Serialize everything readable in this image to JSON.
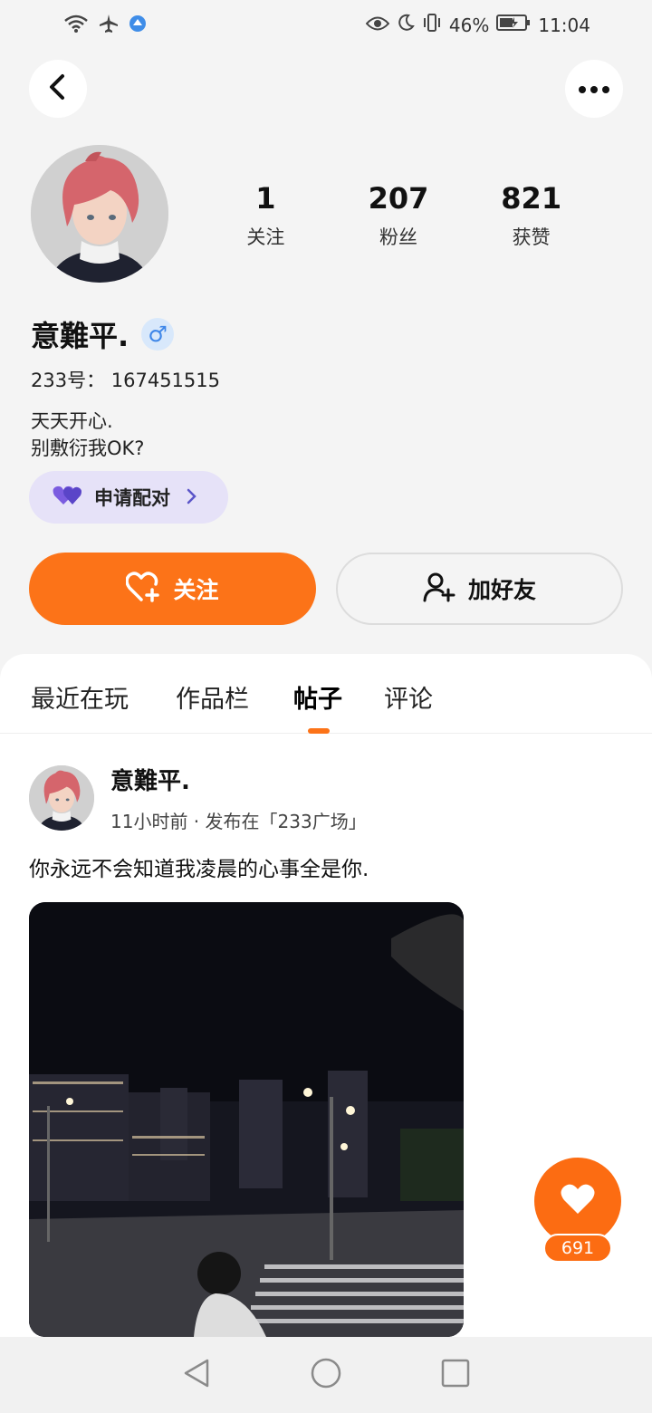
{
  "status_bar": {
    "battery": "46%",
    "time": "11:04"
  },
  "profile": {
    "stats": [
      {
        "value": "1",
        "label": "关注"
      },
      {
        "value": "207",
        "label": "粉丝"
      },
      {
        "value": "821",
        "label": "获赞"
      }
    ],
    "name": "意難平.",
    "gender_symbol": "♂",
    "uid": "233号： 167451515",
    "bio_line1": "天天开心.",
    "bio_line2": "别敷衍我OK?",
    "pair_label": "申请配对",
    "follow_label": "关注",
    "add_friend_label": "加好友"
  },
  "tabs": [
    {
      "label": "最近在玩"
    },
    {
      "label": "作品栏"
    },
    {
      "label": "帖子"
    },
    {
      "label": "评论"
    }
  ],
  "post": {
    "author": "意難平.",
    "meta": "11小时前 · 发布在「233广场」",
    "text": "你永远不会知道我凌晨的心事全是你.",
    "likes": "691"
  },
  "colors": {
    "accent": "#fc7318",
    "pair_bg": "#e6e2f8",
    "gender_bg": "#d8e8fb"
  }
}
